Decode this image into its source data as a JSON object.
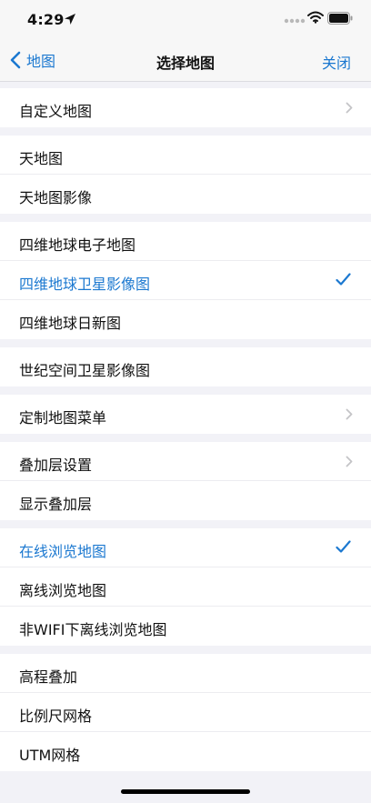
{
  "status_bar": {
    "time": "4:29"
  },
  "nav": {
    "back_label": "地图",
    "title": "选择地图",
    "close_label": "关闭"
  },
  "colors": {
    "accent": "#1b78d0",
    "background": "#f2f2f7"
  },
  "sections": [
    {
      "items": [
        {
          "label": "自定义地图",
          "accessory": "chevron-right-icon",
          "selected": false
        }
      ]
    },
    {
      "items": [
        {
          "label": "天地图",
          "accessory": "",
          "selected": false
        },
        {
          "label": "天地图影像",
          "accessory": "",
          "selected": false
        }
      ]
    },
    {
      "items": [
        {
          "label": "四维地球电子地图",
          "accessory": "",
          "selected": false
        },
        {
          "label": "四维地球卫星影像图",
          "accessory": "checkmark-icon",
          "selected": true
        },
        {
          "label": "四维地球日新图",
          "accessory": "",
          "selected": false
        }
      ]
    },
    {
      "items": [
        {
          "label": "世纪空间卫星影像图",
          "accessory": "",
          "selected": false
        }
      ]
    },
    {
      "items": [
        {
          "label": "定制地图菜单",
          "accessory": "chevron-right-icon",
          "selected": false
        }
      ]
    },
    {
      "items": [
        {
          "label": "叠加层设置",
          "accessory": "chevron-right-icon",
          "selected": false
        },
        {
          "label": "显示叠加层",
          "accessory": "",
          "selected": false
        }
      ]
    },
    {
      "items": [
        {
          "label": "在线浏览地图",
          "accessory": "checkmark-icon",
          "selected": true
        },
        {
          "label": "离线浏览地图",
          "accessory": "",
          "selected": false
        },
        {
          "label": "非WIFI下离线浏览地图",
          "accessory": "",
          "selected": false
        }
      ]
    },
    {
      "items": [
        {
          "label": "高程叠加",
          "accessory": "",
          "selected": false
        },
        {
          "label": "比例尺网格",
          "accessory": "",
          "selected": false
        },
        {
          "label": "UTM网格",
          "accessory": "",
          "selected": false
        }
      ]
    }
  ]
}
